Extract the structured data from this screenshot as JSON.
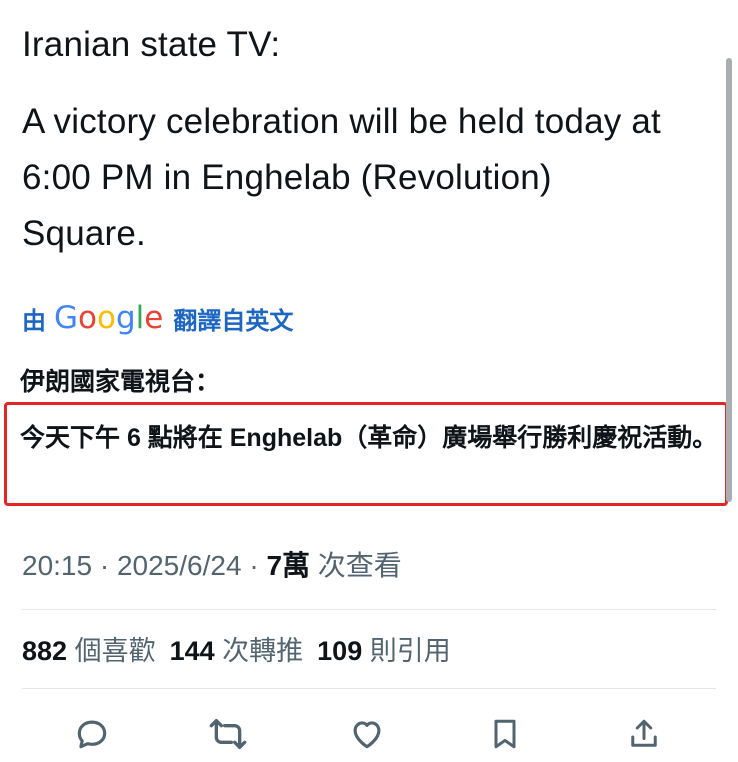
{
  "tweet": {
    "en_title": "Iranian state TV:",
    "en_body": "A victory celebration will be held today at 6:00 PM in Enghelab (Revolution) Square.",
    "translate": {
      "by": "由",
      "provider_letters": [
        "G",
        "o",
        "o",
        "g",
        "l",
        "e"
      ],
      "suffix": "翻譯自英文"
    },
    "zh_title": "伊朗國家電視台：",
    "zh_body": "今天下午 6 點將在 Enghelab（革命）廣場舉行勝利慶祝活動。",
    "meta": {
      "time": "20:15",
      "sep1": " · ",
      "date": "2025/6/24",
      "sep2": " · ",
      "views": "7萬",
      "views_label": " 次查看"
    },
    "stats": {
      "likes": "882",
      "likes_label": "個喜歡",
      "retweets": "144",
      "retweets_label": "次轉推",
      "quotes": "109",
      "quotes_label": "則引用"
    }
  },
  "actions": [
    {
      "icon": "reply-icon"
    },
    {
      "icon": "retweet-icon"
    },
    {
      "icon": "like-icon"
    },
    {
      "icon": "bookmark-icon"
    },
    {
      "icon": "share-icon"
    }
  ],
  "colors": {
    "text": "#0f1419",
    "muted": "#536471",
    "link": "#1d67c2",
    "highlight_border": "#e32526"
  }
}
